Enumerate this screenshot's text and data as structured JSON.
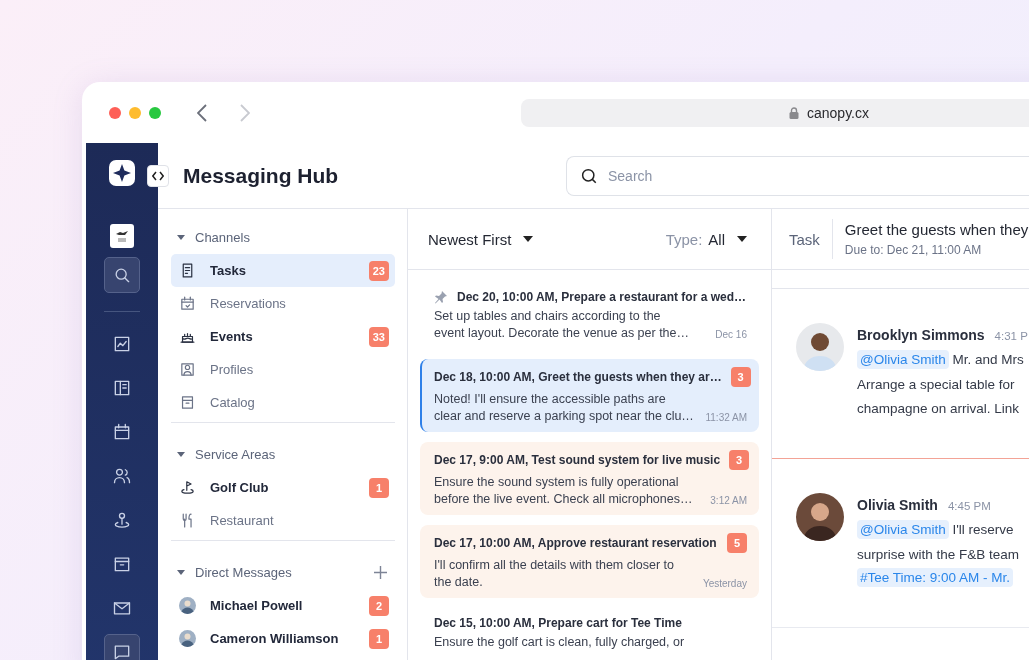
{
  "browser": {
    "url": "canopy.cx"
  },
  "nav": [
    {
      "selected": true
    },
    {
      "selected": false
    },
    {
      "selected": false
    },
    {
      "selected": false
    },
    {
      "selected": false
    },
    {
      "selected": false
    },
    {
      "selected": false
    },
    {
      "selected": false
    },
    {
      "selected": true
    }
  ],
  "header": {
    "title": "Messaging Hub",
    "search": {
      "placeholder": "Search"
    }
  },
  "sections": [
    {
      "title": "Channels",
      "expanded": true,
      "addable": false,
      "items": [
        {
          "kind": "channel",
          "label": "Tasks",
          "badge": "23",
          "selected": true
        },
        {
          "kind": "channel",
          "label": "Reservations",
          "selected": false
        },
        {
          "kind": "channel",
          "label": "Events",
          "badge": "33",
          "selected": false
        },
        {
          "kind": "channel",
          "label": "Profiles",
          "selected": false
        },
        {
          "kind": "channel",
          "label": "Catalog",
          "selected": false
        }
      ]
    },
    {
      "title": "Service Areas",
      "expanded": true,
      "addable": false,
      "items": [
        {
          "kind": "channel",
          "label": "Golf Club",
          "badge": "1",
          "selected": false
        },
        {
          "kind": "channel",
          "label": "Restaurant",
          "selected": false
        }
      ]
    },
    {
      "title": "Direct Messages",
      "expanded": true,
      "addable": true,
      "items": [
        {
          "kind": "person",
          "label": "Michael Powell",
          "badge": "2",
          "selected": false
        },
        {
          "kind": "person",
          "label": "Cameron Williamson",
          "badge": "1",
          "selected": false
        }
      ]
    }
  ],
  "list": {
    "sort": "Newest First",
    "type_label": "Type:",
    "type_value": "All",
    "cards": [
      {
        "title": "Dec 20, 10:00 AM, Prepare a restaurant for a wed…",
        "preview": [
          "Set up tables and chairs according to the",
          "event layout. Decorate the venue as per the…"
        ],
        "time": "Dec 16",
        "pinned": true,
        "selected": false,
        "unread": false
      },
      {
        "title": "Dec 18, 10:00 AM, Greet the guests when they ar…",
        "preview": [
          "Noted! I'll ensure the accessible paths are",
          "clear and reserve a parking spot near the clu…"
        ],
        "time": "11:32 AM",
        "badge": "3",
        "pinned": false,
        "selected": true,
        "unread": false
      },
      {
        "title": "Dec 17, 9:00 AM, Test sound system for live music",
        "preview": [
          "Ensure the sound system is fully operational",
          "before the live event. Check all microphones…"
        ],
        "time": "3:12 AM",
        "badge": "3",
        "pinned": false,
        "selected": false,
        "unread": true
      },
      {
        "title": "Dec 17, 10:00 AM, Approve restaurant reservation",
        "preview": [
          "I'll confirm all the details with them closer to",
          "the date."
        ],
        "time": "Yesterday",
        "badge": "5",
        "pinned": false,
        "selected": false,
        "unread": true
      },
      {
        "title": "Dec 15, 10:00 AM, Prepare cart for Tee Time",
        "preview": [
          "Ensure the golf cart is clean, fully charged, or"
        ],
        "pinned": false,
        "selected": false,
        "unread": false
      }
    ]
  },
  "detail": {
    "label": "Task",
    "title": "Greet the guests when they",
    "due": "Due to: Dec 21, 11:00 AM",
    "messages": [
      {
        "author": "Brooklyn Simmons",
        "time": "4:31 P",
        "mention": "@Olivia Smith",
        "lines": [
          "Mr. and Mrs",
          "Arrange a special table for",
          "champagne on arrival. Link"
        ],
        "unread_marker": false
      },
      {
        "author": "Olivia Smith",
        "time": "4:45 PM",
        "mention": "@Olivia Smith",
        "lines": [
          "I'll reserve",
          "surprise with the F&B team"
        ],
        "tag": "#Tee Time: 9:00 AM - Mr.",
        "unread_marker": true
      }
    ]
  }
}
